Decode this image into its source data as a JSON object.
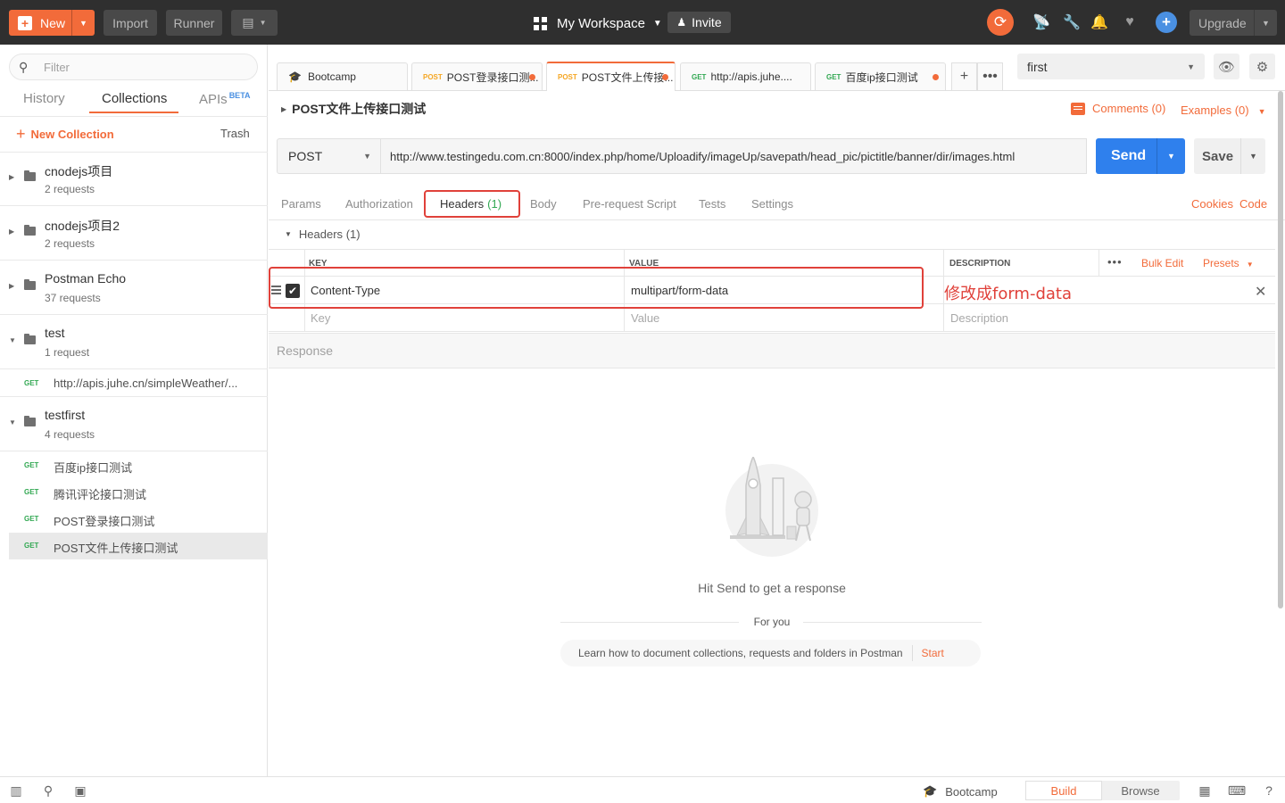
{
  "colors": {
    "accent": "#f26b3a",
    "send": "#2f80ed",
    "get": "#32a852",
    "post": "#f5a623",
    "highlight": "#e0413a"
  },
  "topbar": {
    "new_label": "New",
    "import_label": "Import",
    "runner_label": "Runner",
    "workspace_label": "My Workspace",
    "invite_label": "Invite",
    "upgrade_label": "Upgrade"
  },
  "sidebar": {
    "filter_placeholder": "Filter",
    "tabs": {
      "history": "History",
      "collections": "Collections",
      "apis": "APIs",
      "apis_badge": "BETA"
    },
    "new_collection": "New Collection",
    "trash": "Trash",
    "collections": [
      {
        "name": "cnodejs项目",
        "count": "2 requests"
      },
      {
        "name": "cnodejs项目2",
        "count": "2 requests"
      },
      {
        "name": "Postman Echo",
        "count": "37 requests"
      },
      {
        "name": "test",
        "count": "1 request"
      },
      {
        "name": "testfirst",
        "count": "4 requests"
      }
    ],
    "requests": [
      {
        "method": "GET",
        "name": "http://apis.juhe.cn/simpleWeather/..."
      },
      {
        "method": "GET",
        "name": "百度ip接口测试"
      },
      {
        "method": "GET",
        "name": "腾讯评论接口测试"
      },
      {
        "method": "GET",
        "name": "POST登录接口测试"
      },
      {
        "method": "GET",
        "name": "POST文件上传接口测试"
      }
    ]
  },
  "tabs": [
    {
      "method": "",
      "label": "Bootcamp"
    },
    {
      "method": "POST",
      "label": "POST登录接口测..."
    },
    {
      "method": "POST",
      "label": "POST文件上传接..."
    },
    {
      "method": "GET",
      "label": "http://apis.juhe...."
    },
    {
      "method": "GET",
      "label": "百度ip接口测试"
    }
  ],
  "environment": {
    "selected": "first"
  },
  "request": {
    "title": "POST文件上传接口测试",
    "comments": "Comments (0)",
    "examples": "Examples (0)",
    "method": "POST",
    "url": "http://www.testingedu.com.cn:8000/index.php/home/Uploadify/imageUp/savepath/head_pic/pictitle/banner/dir/images.html",
    "send_label": "Send",
    "save_label": "Save",
    "subtabs": {
      "params": "Params",
      "authorization": "Authorization",
      "headers": "Headers",
      "headers_count": "(1)",
      "body": "Body",
      "prerequest": "Pre-request Script",
      "tests": "Tests",
      "settings": "Settings"
    },
    "cookies": "Cookies",
    "code": "Code"
  },
  "headers": {
    "section_title": "Headers",
    "section_count": "(1)",
    "columns": {
      "key": "KEY",
      "value": "VALUE",
      "description": "DESCRIPTION"
    },
    "bulk_edit": "Bulk Edit",
    "presets": "Presets",
    "rows": [
      {
        "key": "Content-Type",
        "value": "multipart/form-data",
        "enabled": true
      }
    ],
    "placeholders": {
      "key": "Key",
      "value": "Value",
      "description": "Description"
    },
    "annotation": "修改成form-data"
  },
  "response": {
    "title": "Response",
    "hint": "Hit Send to get a response",
    "for_you": "For you",
    "learn_text": "Learn how to document collections, requests and folders in Postman",
    "start_label": "Start"
  },
  "statusbar": {
    "bootcamp": "Bootcamp",
    "build": "Build",
    "browse": "Browse"
  }
}
